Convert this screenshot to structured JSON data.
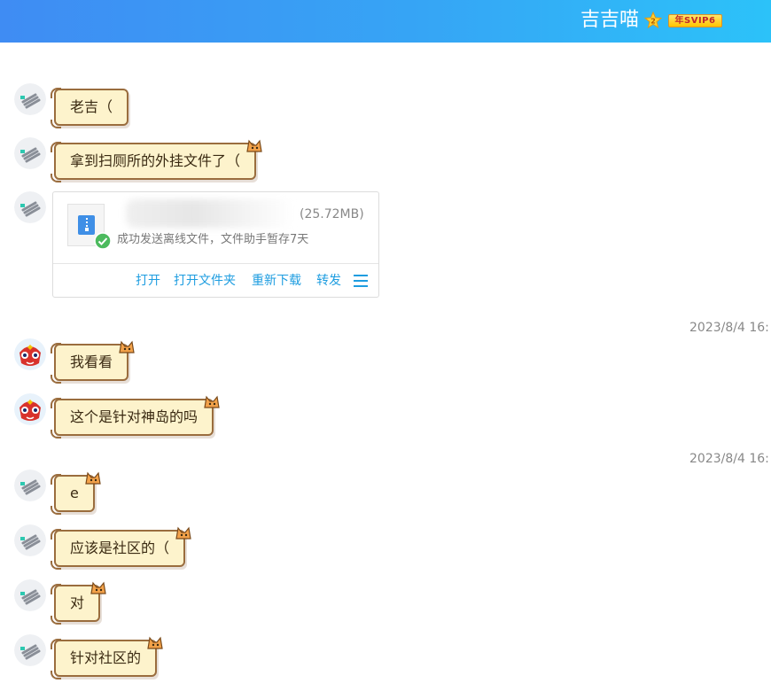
{
  "header": {
    "contact_name": "吉吉喵",
    "star_icon": "star-icon",
    "star_level": "2",
    "vip_badge": "年SVIP6",
    "gradient_start": "#3f8cf3",
    "gradient_end": "#2cc2f9"
  },
  "messages": [
    {
      "sender": "other",
      "text": "老吉（"
    },
    {
      "sender": "other",
      "text": "拿到扫厕所的外挂文件了（"
    },
    {
      "sender": "other",
      "type": "file"
    },
    {
      "sender": "self",
      "text": "我看看"
    },
    {
      "sender": "self",
      "text": "这个是针对神岛的吗"
    },
    {
      "sender": "other",
      "text": "e"
    },
    {
      "sender": "other",
      "text": "应该是社区的（"
    },
    {
      "sender": "other",
      "text": "对"
    },
    {
      "sender": "other",
      "text": "针对社区的"
    }
  ],
  "timestamps": [
    "2023/8/4 16:",
    "2023/8/4 16:"
  ],
  "file": {
    "size": "(25.72MB)",
    "status": "成功发送离线文件，文件助手暂存7天",
    "actions": [
      "打开",
      "打开文件夹",
      "重新下载",
      "转发"
    ],
    "action_color": "#1e9de0"
  },
  "bubble_colors": {
    "fill": "#fdf3cc",
    "border": "#9a6d3e"
  }
}
